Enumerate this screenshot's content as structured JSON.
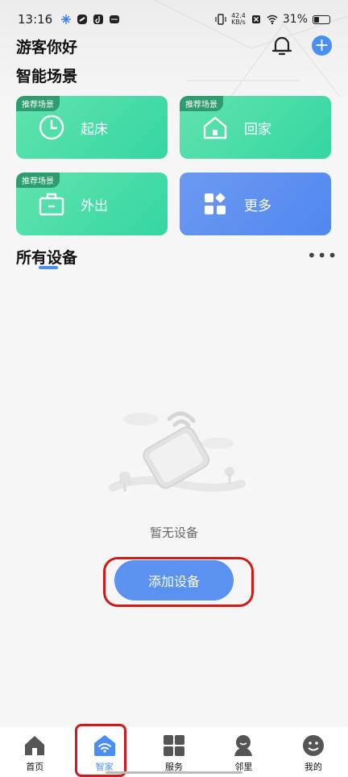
{
  "status_bar": {
    "time": "13:16",
    "net_speed_value": "42.4",
    "net_speed_unit": "KB/s",
    "battery": "31%"
  },
  "header": {
    "greeting": "游客你好"
  },
  "scenes": {
    "title": "智能场景",
    "tag": "推荐场景",
    "items": [
      {
        "label": "起床",
        "icon": "clock-icon"
      },
      {
        "label": "回家",
        "icon": "home-icon"
      },
      {
        "label": "外出",
        "icon": "bag-icon"
      },
      {
        "label": "更多",
        "icon": "grid-icon"
      }
    ]
  },
  "devices": {
    "title": "所有设备",
    "empty_text": "暂无设备",
    "add_button": "添加设备"
  },
  "bottom_nav": {
    "items": [
      {
        "label": "首页"
      },
      {
        "label": "智家"
      },
      {
        "label": "服务"
      },
      {
        "label": "邻里"
      },
      {
        "label": "我的"
      }
    ],
    "active_index": 1
  },
  "colors": {
    "accent": "#4a8ff0",
    "scene_green": "#33d6a2",
    "scene_blue": "#5187ef",
    "highlight": "#d11a1a"
  }
}
